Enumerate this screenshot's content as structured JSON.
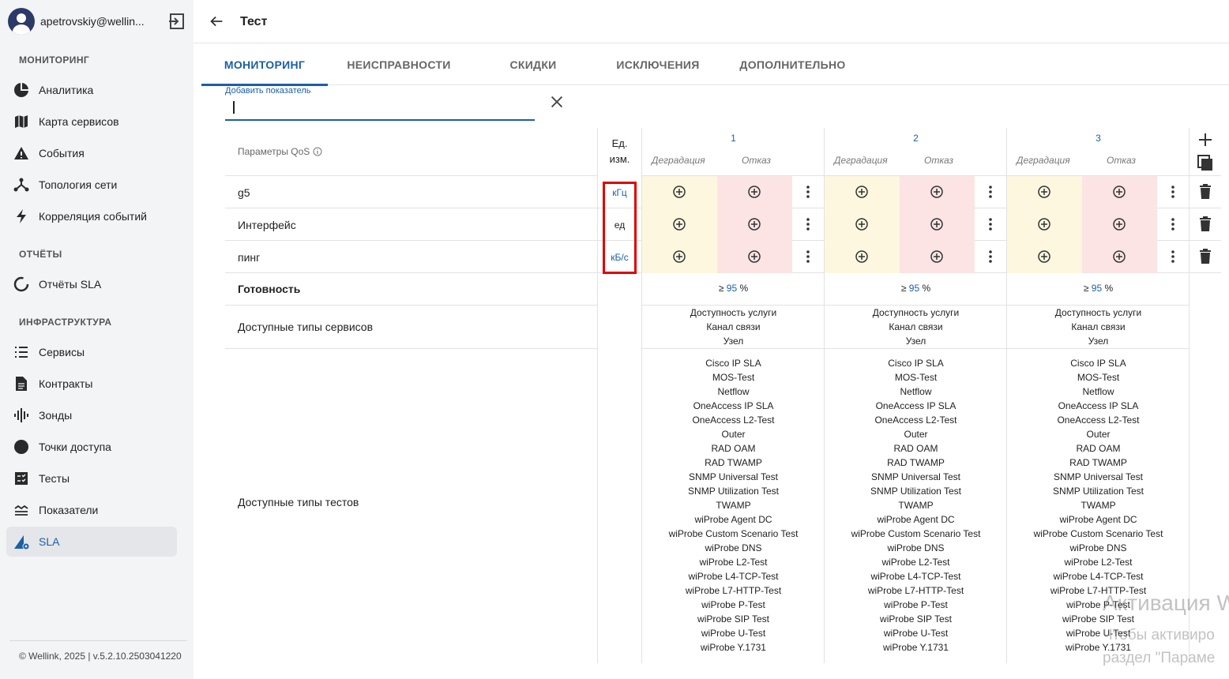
{
  "user": {
    "email": "apetrovskiy@wellin..."
  },
  "sidebar": {
    "sections": [
      {
        "title": "МОНИТОРИНГ",
        "items": [
          {
            "label": "Аналитика",
            "icon": "pie-chart-icon"
          },
          {
            "label": "Карта сервисов",
            "icon": "map-icon"
          },
          {
            "label": "События",
            "icon": "warning-icon"
          },
          {
            "label": "Топология сети",
            "icon": "topology-icon"
          },
          {
            "label": "Корреляция событий",
            "icon": "lightning-icon"
          }
        ]
      },
      {
        "title": "ОТЧЁТЫ",
        "items": [
          {
            "label": "Отчёты SLA",
            "icon": "report-circle-icon"
          }
        ]
      },
      {
        "title": "ИНФРАСТРУКТУРА",
        "items": [
          {
            "label": "Сервисы",
            "icon": "list-icon"
          },
          {
            "label": "Контракты",
            "icon": "document-icon"
          },
          {
            "label": "Зонды",
            "icon": "probe-icon"
          },
          {
            "label": "Точки доступа",
            "icon": "dot-icon"
          },
          {
            "label": "Тесты",
            "icon": "tests-icon"
          },
          {
            "label": "Показатели",
            "icon": "indicators-icon"
          },
          {
            "label": "SLA",
            "icon": "sla-icon",
            "active": true
          }
        ]
      }
    ],
    "footer": "© Wellink, 2025 | v.5.2.10.2503041220"
  },
  "header": {
    "title": "Тест"
  },
  "tabs": [
    {
      "label": "МОНИТОРИНГ",
      "active": true
    },
    {
      "label": "НЕИСПРАВНОСТИ"
    },
    {
      "label": "СКИДКИ"
    },
    {
      "label": "ИСКЛЮЧЕНИЯ"
    },
    {
      "label": "ДОПОЛНИТЕЛЬНО"
    }
  ],
  "add_indicator": {
    "label": "Добавить показатель",
    "value": ""
  },
  "table": {
    "qos_header": "Параметры QoS",
    "unit_header_line1": "Ед.",
    "unit_header_line2": "изм.",
    "columns": [
      {
        "number": "1",
        "degradation": "Деградация",
        "failure": "Отказ"
      },
      {
        "number": "2",
        "degradation": "Деградация",
        "failure": "Отказ"
      },
      {
        "number": "3",
        "degradation": "Деградация",
        "failure": "Отказ"
      }
    ],
    "rows": [
      {
        "name": "g5",
        "unit": "кГц",
        "unit_color": "#1b5fa8"
      },
      {
        "name": "Интерфейс",
        "unit": "ед",
        "unit_color": "#222222"
      },
      {
        "name": "пинг",
        "unit": "кБ/с",
        "unit_color": "#1b5fa8"
      }
    ],
    "availability_label": "Готовность",
    "availability_prefix": "≥",
    "availability_value": "95",
    "availability_suffix": "%",
    "service_types_label": "Доступные типы сервисов",
    "service_types": [
      "Доступность услуги",
      "Канал связи",
      "Узел"
    ],
    "test_types_label": "Доступные типы тестов",
    "test_types": [
      "Cisco IP SLA",
      "MOS-Test",
      "Netflow",
      "OneAccess IP SLA",
      "OneAccess L2-Test",
      "Outer",
      "RAD OAM",
      "RAD TWAMP",
      "SNMP Universal Test",
      "SNMP Utilization Test",
      "TWAMP",
      "wiProbe Agent DC",
      "wiProbe Custom Scenario Test",
      "wiProbe DNS",
      "wiProbe L2-Test",
      "wiProbe L4-TCP-Test",
      "wiProbe L7-HTTP-Test",
      "wiProbe P-Test",
      "wiProbe SIP Test",
      "wiProbe U-Test",
      "wiProbe Y.1731"
    ]
  },
  "watermark": {
    "line1": "Активация W",
    "line2": "Чтобы активиро",
    "line3": "раздел \"Параме"
  }
}
